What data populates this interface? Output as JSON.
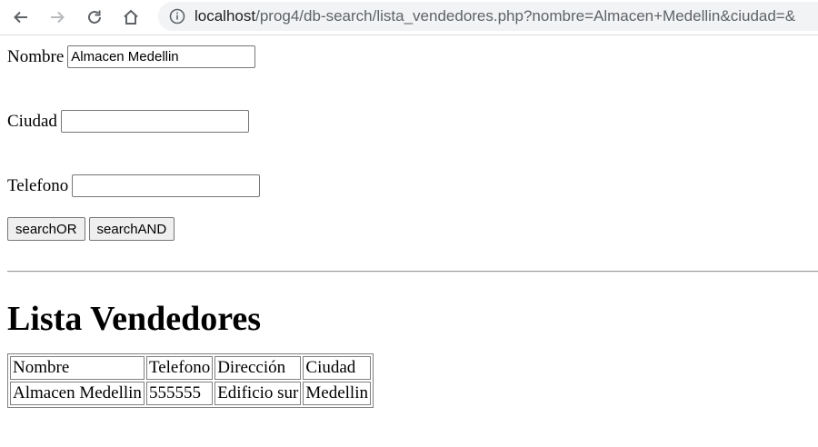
{
  "browser": {
    "url_host": "localhost",
    "url_path": "/prog4/db-search/lista_vendedores.php?nombre=Almacen+Medellin&ciudad=&"
  },
  "form": {
    "nombre_label": "Nombre",
    "nombre_value": "Almacen Medellin",
    "ciudad_label": "Ciudad",
    "ciudad_value": "",
    "telefono_label": "Telefono",
    "telefono_value": "",
    "search_or_label": "searchOR",
    "search_and_label": "searchAND"
  },
  "heading": "Lista Vendedores",
  "table": {
    "headers": [
      "Nombre",
      "Telefono",
      "Dirección",
      "Ciudad"
    ],
    "rows": [
      [
        "Almacen Medellin",
        "555555",
        "Edificio sur",
        "Medellin"
      ]
    ]
  }
}
